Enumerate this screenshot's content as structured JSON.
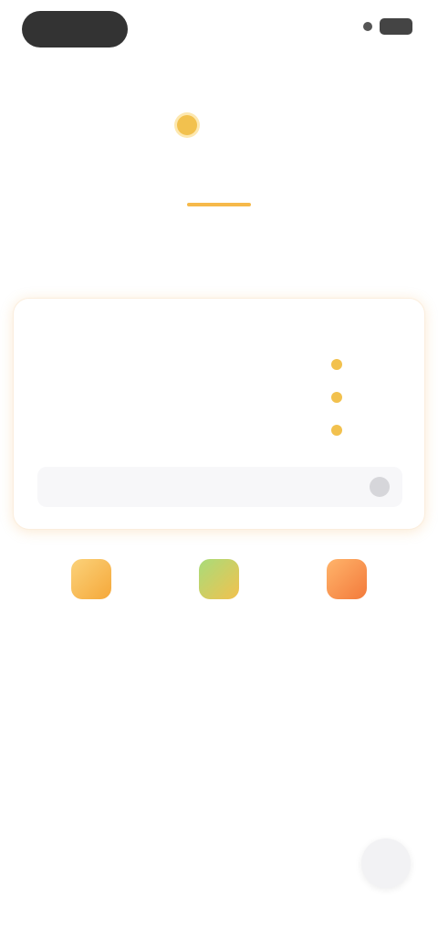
{
  "header": {
    "title": ""
  },
  "balance": {
    "value": ""
  },
  "tabs": [
    {
      "label": ""
    },
    {
      "label": ""
    },
    {
      "label": ""
    }
  ],
  "headline": "",
  "card": {
    "title": "",
    "rows": [
      {
        "label": "",
        "value": ""
      },
      {
        "label": "",
        "value": ""
      },
      {
        "label": "",
        "value": ""
      }
    ],
    "info_text": ""
  },
  "shortcuts": [
    {
      "label": ""
    },
    {
      "label": ""
    },
    {
      "label": ""
    }
  ],
  "colors": {
    "accent": "#f6b94a",
    "coin": "#f2c14e",
    "shortcut_orange": "#f37a3b",
    "shortcut_green": "#a8dc7a"
  },
  "icons": {
    "coin": "coin-icon",
    "shortcut_1": "gift-icon",
    "shortcut_2": "task-icon",
    "shortcut_3": "shop-icon",
    "info_toggle": "chevron-icon",
    "floating": "service-icon"
  }
}
